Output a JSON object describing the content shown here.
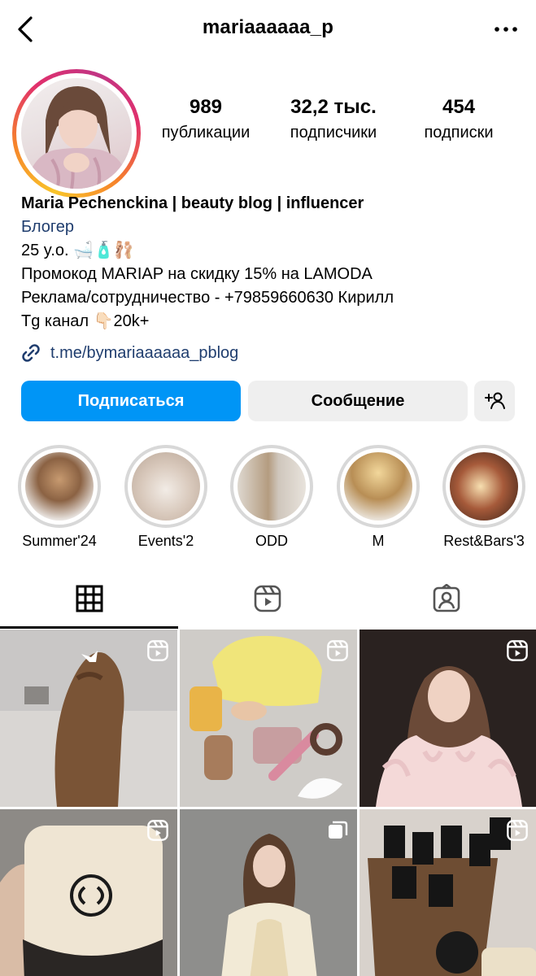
{
  "header": {
    "username": "mariaaaaaa_p"
  },
  "stats": [
    {
      "value": "989",
      "label": "публикации"
    },
    {
      "value": "32,2 тыс.",
      "label": "подписчики"
    },
    {
      "value": "454",
      "label": "подписки"
    }
  ],
  "bio": {
    "name": "Maria Pechenckina | beauty blog | influencer",
    "category": "Блогер",
    "lines": [
      "25 y.o. 🛁🧴🩰",
      "Промокод MARIAP на скидку 15% на LAMODA",
      "Реклама/сотрудничество - +79859660630 Кирилл",
      "Tg канал 👇🏻20k+"
    ],
    "link": "t.me/bymariaaaaaa_pblog"
  },
  "actions": {
    "follow": "Подписаться",
    "message": "Сообщение"
  },
  "highlights": [
    {
      "label": "Summer'24"
    },
    {
      "label": "Events'2"
    },
    {
      "label": "ODD"
    },
    {
      "label": "M"
    },
    {
      "label": "Rest&Bars'3"
    }
  ],
  "tabs": [
    "grid-icon",
    "reels-icon",
    "tagged-icon"
  ],
  "colors": {
    "accent": "#0095f6",
    "link": "#1f3d6e",
    "secondary_button": "#efefef"
  }
}
